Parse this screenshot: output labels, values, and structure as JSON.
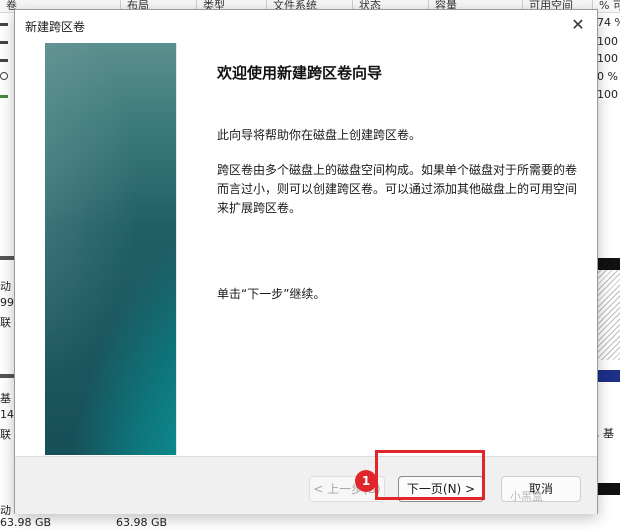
{
  "background": {
    "columns": [
      "卷",
      "布局",
      "类型",
      "文件系统",
      "状态",
      "容量",
      "可用空间",
      "% 可"
    ],
    "pct_values": [
      "74 %",
      "100",
      "100",
      "0 %",
      "100"
    ],
    "left_labels": [
      "动",
      "99",
      "联",
      "基",
      "14",
      "联"
    ],
    "bottom_left": "63.98 GB",
    "bottom_mid": "63.98 GB",
    "bottom_row": "动",
    "right_fragment": ", 基"
  },
  "dialog": {
    "title": "新建跨区卷",
    "close_glyph": "✕",
    "heading": "欢迎使用新建跨区卷向导",
    "para1": "此向导将帮助你在磁盘上创建跨区卷。",
    "para2": "跨区卷由多个磁盘上的磁盘空间构成。如果单个磁盘对于所需要的卷而言过小，则可以创建跨区卷。可以通过添加其他磁盘上的可用空间来扩展跨区卷。",
    "para3": "单击“下一步”继续。"
  },
  "buttons": {
    "back_label": "< 上一步(B)",
    "next_label": "下一页(N) >",
    "cancel_label": "取消"
  },
  "annotation": {
    "badge_number": "1",
    "highlight_color": "#e0262a"
  },
  "watermark": "小黑盒"
}
